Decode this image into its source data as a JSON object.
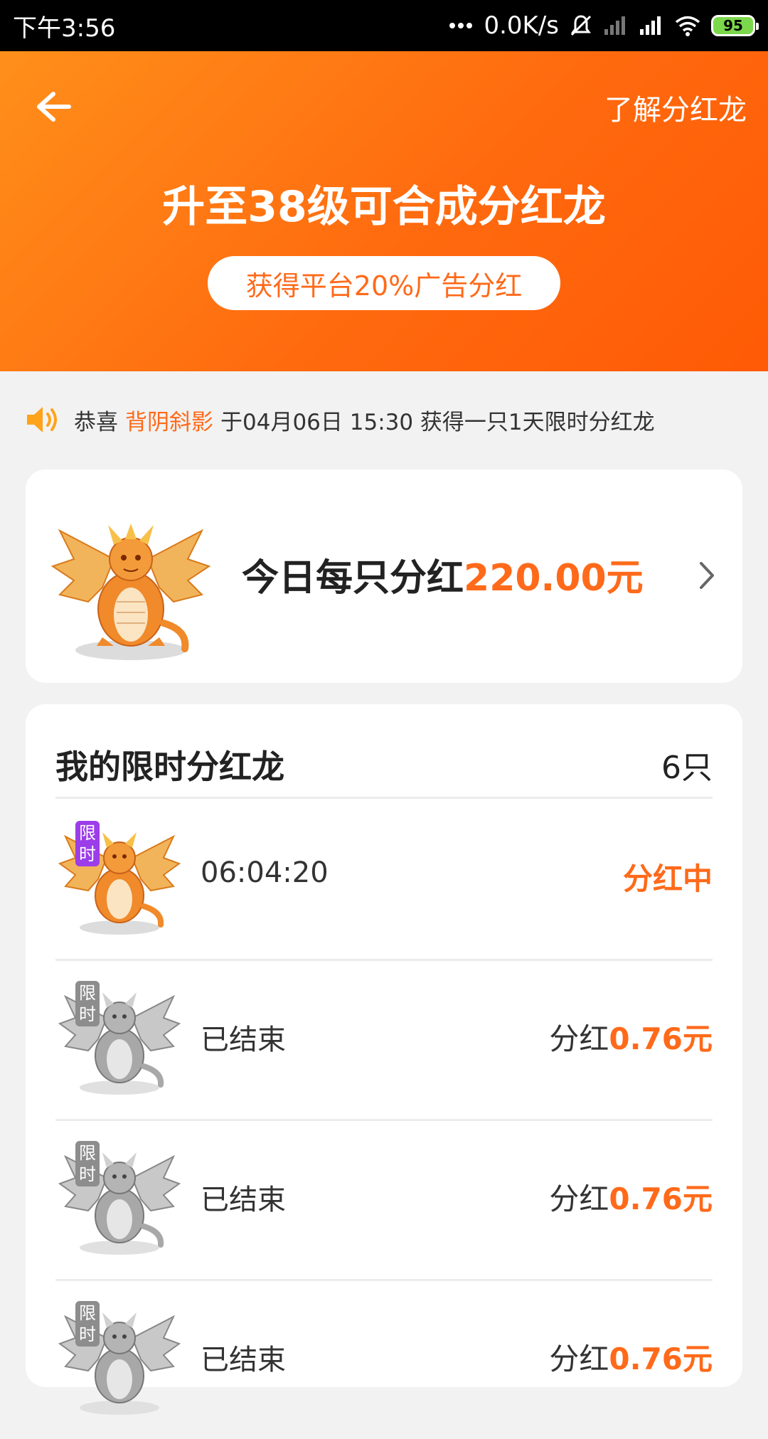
{
  "status_bar": {
    "time": "下午3:56",
    "speed": "0.0K/s",
    "battery": "95"
  },
  "header": {
    "about_link": "了解分红龙",
    "title": "升至38级可合成分红龙",
    "pill": "获得平台20%广告分红"
  },
  "notice": {
    "prefix": "恭喜",
    "username": "背阴斜影",
    "message": "于04月06日 15:30 获得一只1天限时分红龙"
  },
  "dividend_card": {
    "label": "今日每只分红",
    "amount": "220.00元"
  },
  "my_dragons": {
    "title": "我的限时分红龙",
    "count": "6只",
    "badge_text": "限时",
    "items": [
      {
        "text": "06:04:20",
        "status": "分红中"
      },
      {
        "text": "已结束",
        "amount_prefix": "分红",
        "amount_value": "0.76元"
      },
      {
        "text": "已结束",
        "amount_prefix": "分红",
        "amount_value": "0.76元"
      },
      {
        "text": "已结束",
        "amount_prefix": "分红",
        "amount_value": "0.76元"
      }
    ]
  },
  "colors": {
    "accent": "#ff6a1a",
    "header_gradient_start": "#ff8f1a",
    "header_gradient_end": "#ff5a05",
    "badge_active": "#9b3de8",
    "badge_ended": "#8d8d8d"
  },
  "icons": {
    "back": "arrow-left-icon",
    "speaker": "speaker-icon",
    "chevron": "chevron-right-icon",
    "dragon": "dragon-icon"
  }
}
